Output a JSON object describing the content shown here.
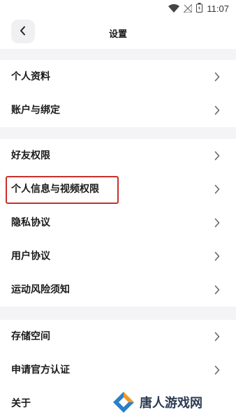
{
  "status_bar": {
    "time": "11:07",
    "icons": [
      "wifi-icon",
      "signal-icon",
      "battery-icon"
    ]
  },
  "header": {
    "title": "设置",
    "back_icon": "chevron-left-icon"
  },
  "sections": [
    {
      "items": [
        {
          "label": "个人资料"
        },
        {
          "label": "账户与绑定"
        }
      ]
    },
    {
      "items": [
        {
          "label": "好友权限"
        },
        {
          "label": "个人信息与视频权限",
          "highlighted": true
        },
        {
          "label": "隐私协议"
        },
        {
          "label": "用户协议"
        },
        {
          "label": "运动风险须知"
        }
      ]
    },
    {
      "items": [
        {
          "label": "存储空间"
        },
        {
          "label": "申请官方认证"
        },
        {
          "label": "关于"
        }
      ]
    }
  ],
  "watermark": {
    "text": "唐人游戏网"
  },
  "colors": {
    "background": "#f4f4f6",
    "surface": "#ffffff",
    "highlight": "#c9302c",
    "logo_blue": "#2a7fc9",
    "logo_orange": "#f39a1e"
  }
}
